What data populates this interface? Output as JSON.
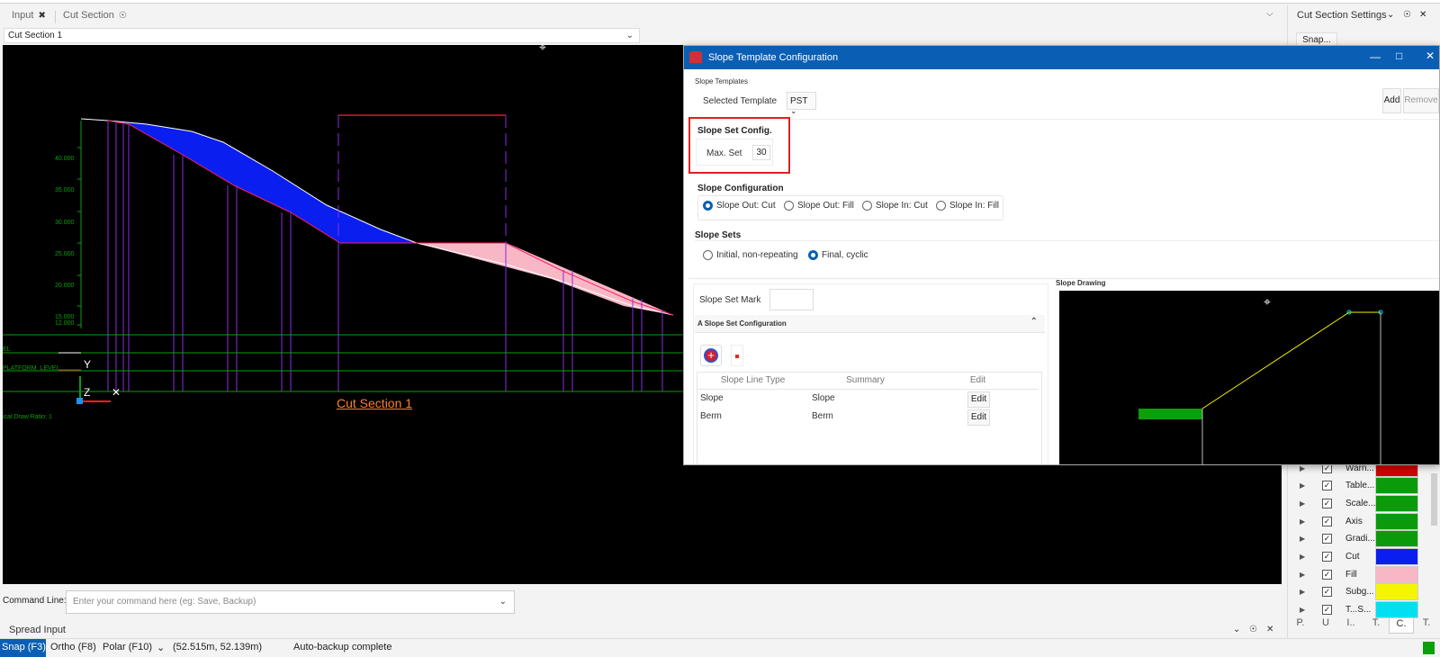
{
  "tabs": [
    {
      "label": "Input"
    },
    {
      "label": "Cut Section"
    }
  ],
  "section_select": {
    "value": "Cut Section 1"
  },
  "right_panel": {
    "title": "Cut Section Settings",
    "snap_button": "Snap...",
    "layers": [
      {
        "label": "Warn...",
        "color": "#d00000"
      },
      {
        "label": "Table...",
        "color": "#0a9a0a"
      },
      {
        "label": "Scale...",
        "color": "#0a9a0a"
      },
      {
        "label": "Axis",
        "color": "#0a9a0a"
      },
      {
        "label": "Gradi...",
        "color": "#0a9a0a"
      },
      {
        "label": "Cut",
        "color": "#0a1ef0"
      },
      {
        "label": "Fill",
        "color": "#f7b7c5"
      },
      {
        "label": "Subg...",
        "color": "#f5f500"
      },
      {
        "label": "T...S...",
        "color": "#00e0f0"
      }
    ],
    "bottom_tabs": [
      "P.",
      "U",
      "I..",
      "T.",
      "C.",
      "T."
    ]
  },
  "canvas": {
    "section_title": "Cut Section 1",
    "y_labels": [
      "40.000",
      "35.000",
      "30.000",
      "25.000",
      "20.000",
      "15.000",
      "12.000"
    ],
    "row_labels": [
      "EL",
      "PLATFORM_LEVEL"
    ],
    "draw_ratio": "ical Draw Ratio: 1",
    "axis_y": "Y",
    "axis_z": "Z"
  },
  "command": {
    "label": "Command Line:",
    "placeholder": "Enter your command here (eg: Save, Backup)"
  },
  "spread_input": {
    "label": "Spread Input"
  },
  "status": {
    "snap": "Snap (F3)",
    "ortho": "Ortho (F8)",
    "polar": "Polar (F10)",
    "coords": "(52.515m, 52.139m)",
    "message": "Auto-backup complete"
  },
  "dialog": {
    "title": "Slope Template Configuration",
    "templates_group": "Slope Templates",
    "selected_template_label": "Selected Template",
    "selected_template_value": "PST",
    "add_button": "Add",
    "remove_button": "Remove",
    "set_config_title": "Slope Set Config.",
    "max_set_label": "Max. Set",
    "max_set_value": "30",
    "slope_config_title": "Slope Configuration",
    "slope_options": [
      "Slope Out: Cut",
      "Slope Out: Fill",
      "Slope In: Cut",
      "Slope In: Fill"
    ],
    "slope_sets_title": "Slope Sets",
    "set_options": [
      "Initial, non-repeating",
      "Final, cyclic"
    ],
    "set_mark_label": "Slope Set Mark",
    "set_mark_value": "",
    "expander_title": "A Slope Set Configuration",
    "grid_headers": [
      "Slope Line Type",
      "Summary",
      "Edit"
    ],
    "grid_rows": [
      {
        "type": "Slope",
        "summary": "Slope",
        "edit": "Edit"
      },
      {
        "type": "Berm",
        "summary": "Berm",
        "edit": "Edit"
      }
    ],
    "drawing_title": "Slope Drawing"
  }
}
